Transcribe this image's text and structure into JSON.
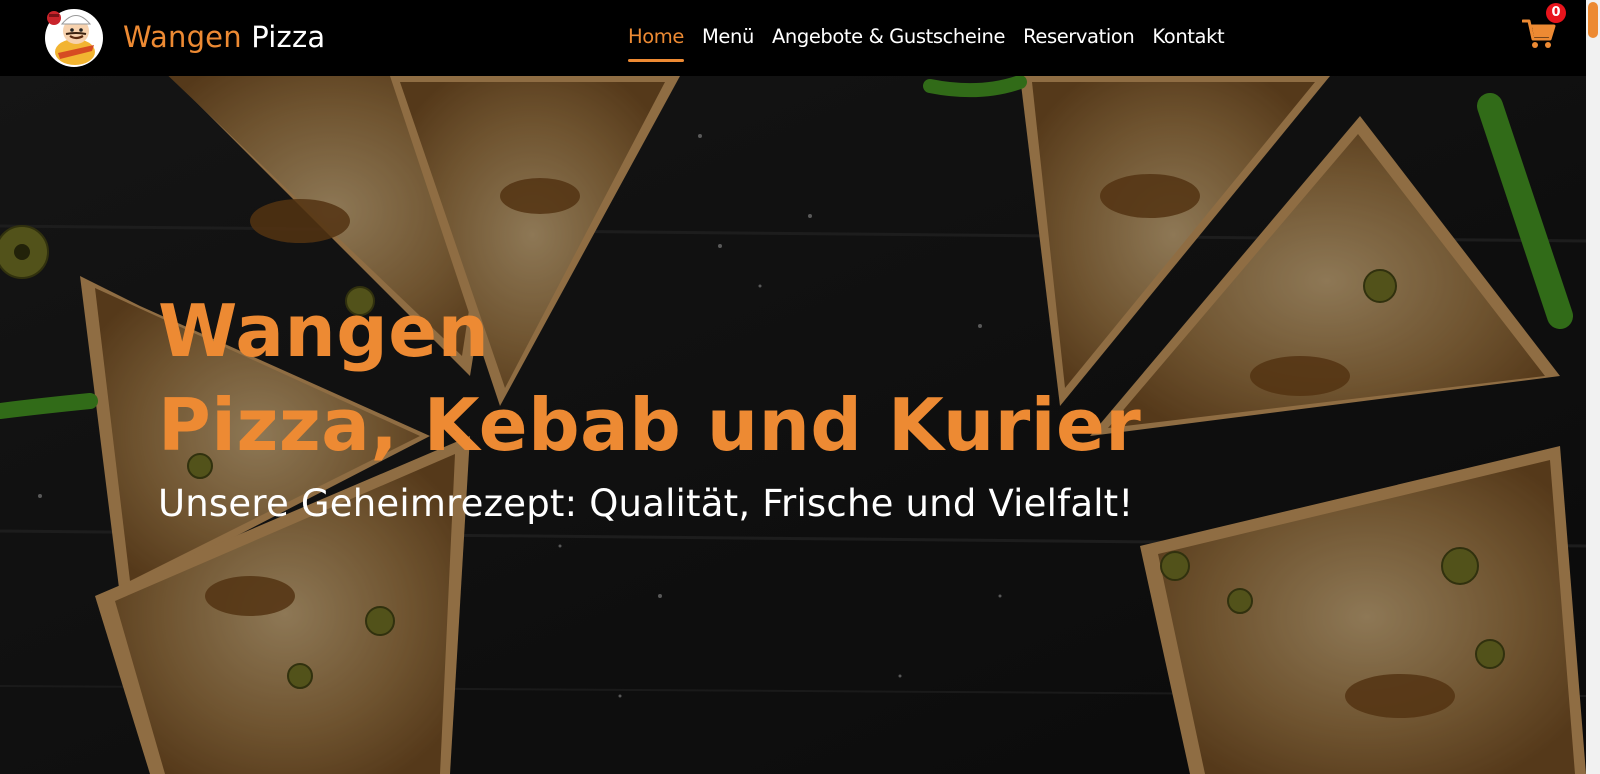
{
  "header": {
    "brand_first": "Wangen",
    "brand_second": "Pizza",
    "logo_icon": "chef-mascot-icon",
    "nav": [
      {
        "label": "Home",
        "active": true
      },
      {
        "label": "Menü",
        "active": false
      },
      {
        "label": "Angebote & Gustscheine",
        "active": false
      },
      {
        "label": "Reservation",
        "active": false
      },
      {
        "label": "Kontakt",
        "active": false
      }
    ],
    "cart": {
      "icon": "shopping-cart-icon",
      "count": "0"
    }
  },
  "hero": {
    "title_line1": "Wangen",
    "title_line2": "Pizza, Kebab und Kurier",
    "subtitle": "Unsere Geheimrezept: Qualität, Frische und Vielfalt!"
  },
  "colors": {
    "accent": "#ed8a33",
    "header_bg": "#000000",
    "badge": "#e8141c",
    "text_light": "#ffffff"
  }
}
